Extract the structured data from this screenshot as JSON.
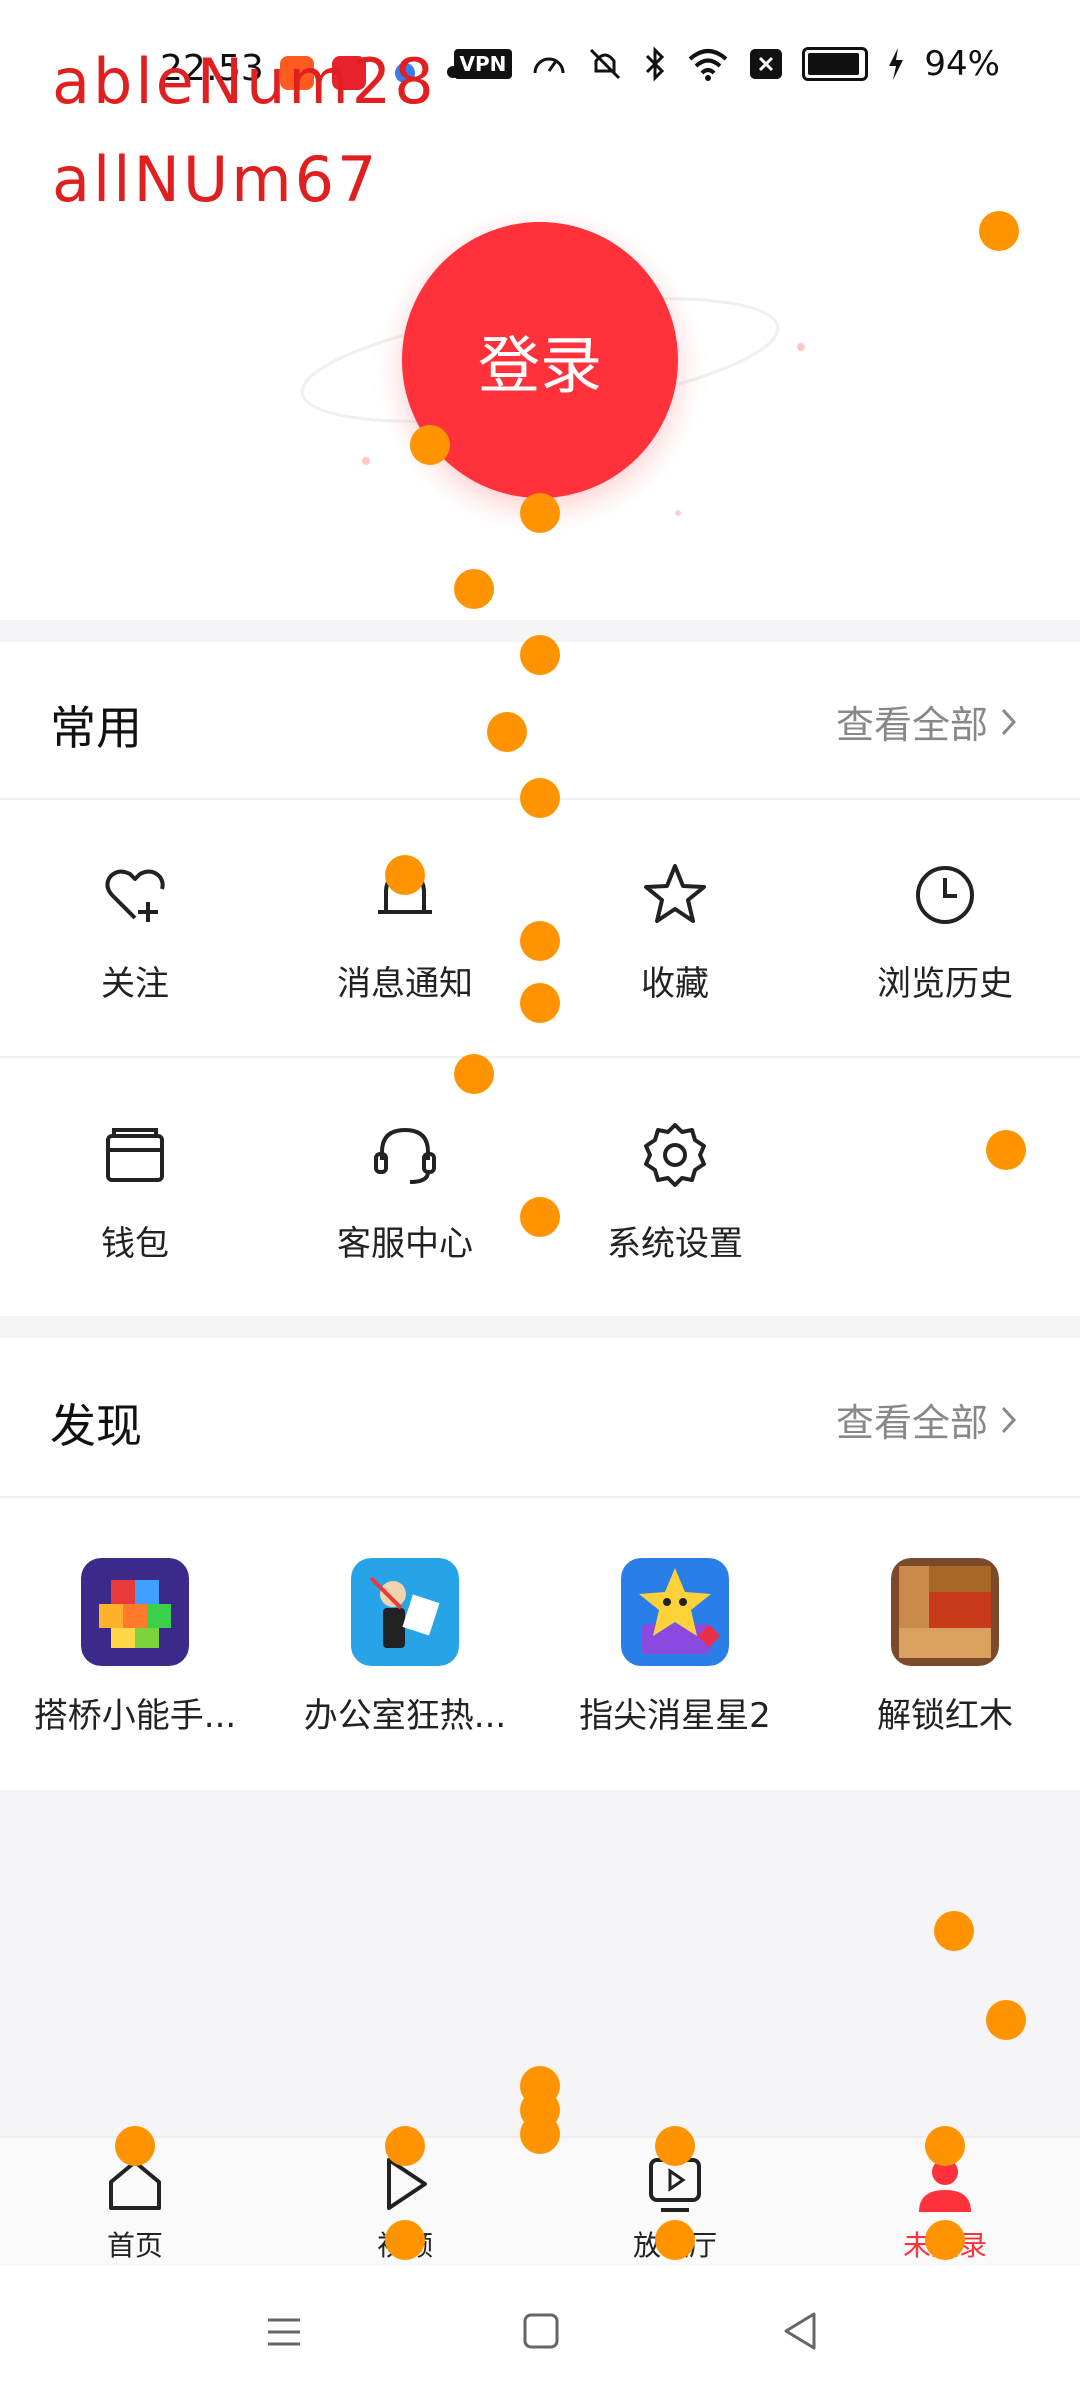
{
  "status_bar": {
    "time": "22:53",
    "vpn_label": "VPN",
    "battery_percent": "94%",
    "battery_level": 0.94
  },
  "overlay": {
    "line1": "ableNum28",
    "line2": "allNUm67"
  },
  "hero": {
    "login_label": "登录"
  },
  "common": {
    "title": "常用",
    "view_all": "查看全部",
    "items": [
      {
        "label": "关注",
        "icon": "heart-plus-icon"
      },
      {
        "label": "消息通知",
        "icon": "bell-icon"
      },
      {
        "label": "收藏",
        "icon": "star-icon"
      },
      {
        "label": "浏览历史",
        "icon": "clock-icon"
      },
      {
        "label": "钱包",
        "icon": "wallet-icon"
      },
      {
        "label": "客服中心",
        "icon": "headset-icon"
      },
      {
        "label": "系统设置",
        "icon": "gear-icon"
      }
    ]
  },
  "discover": {
    "title": "发现",
    "view_all": "查看全部",
    "apps": [
      {
        "label": "搭桥小能手...",
        "icon": "cubes-game-icon"
      },
      {
        "label": "办公室狂热...",
        "icon": "office-game-icon"
      },
      {
        "label": "指尖消星星2",
        "icon": "star-game-icon"
      },
      {
        "label": "解锁红木",
        "icon": "wood-game-icon"
      }
    ]
  },
  "bottom_nav": {
    "items": [
      {
        "label": "首页",
        "icon": "home-icon"
      },
      {
        "label": "视频",
        "icon": "play-icon"
      },
      {
        "label": "放映厅",
        "icon": "screening-room-icon"
      },
      {
        "label": "未登录",
        "icon": "user-icon"
      }
    ],
    "active_index": 3
  },
  "colors": {
    "accent": "#ff323c",
    "dot": "#ff9400",
    "overlay_text": "#e02020"
  }
}
